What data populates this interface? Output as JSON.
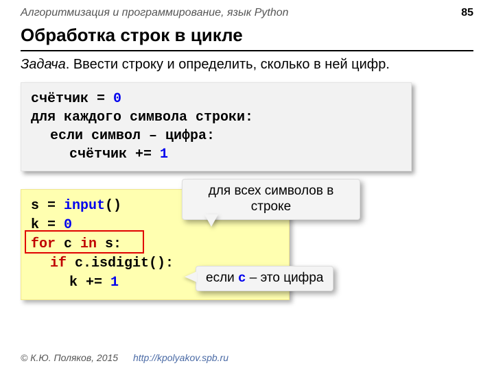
{
  "header": {
    "course": "Алгоритмизация и программирование, язык Python",
    "page_number": "85"
  },
  "title": "Обработка строк в цикле",
  "task": {
    "label": "Задача",
    "text": "Ввести строку и определить, сколько в ней цифр."
  },
  "pseudo": {
    "line1_a": "счётчик = ",
    "line1_num": "0",
    "line2": "для каждого символа строки:",
    "line3": "если символ – цифра:",
    "line4_a": "счётчик += ",
    "line4_num": "1"
  },
  "code": {
    "l1_var": "s = ",
    "l1_fn": "input",
    "l1_call": "()",
    "l2_a": "k = ",
    "l2_num": "0",
    "l3_for": "for",
    "l3_mid": " c ",
    "l3_in": "in",
    "l3_end": " s:",
    "l4_if": "if",
    "l4_rest": " c.isdigit():",
    "l5_a": "k += ",
    "l5_num": "1"
  },
  "callouts": {
    "c1_line1": "для всех символов в",
    "c1_line2": "строке",
    "c2_pre": "если ",
    "c2_code": "c",
    "c2_post": " – это цифра"
  },
  "footer": {
    "copyright": "© К.Ю. Поляков, 2015",
    "url": "http://kpolyakov.spb.ru"
  }
}
